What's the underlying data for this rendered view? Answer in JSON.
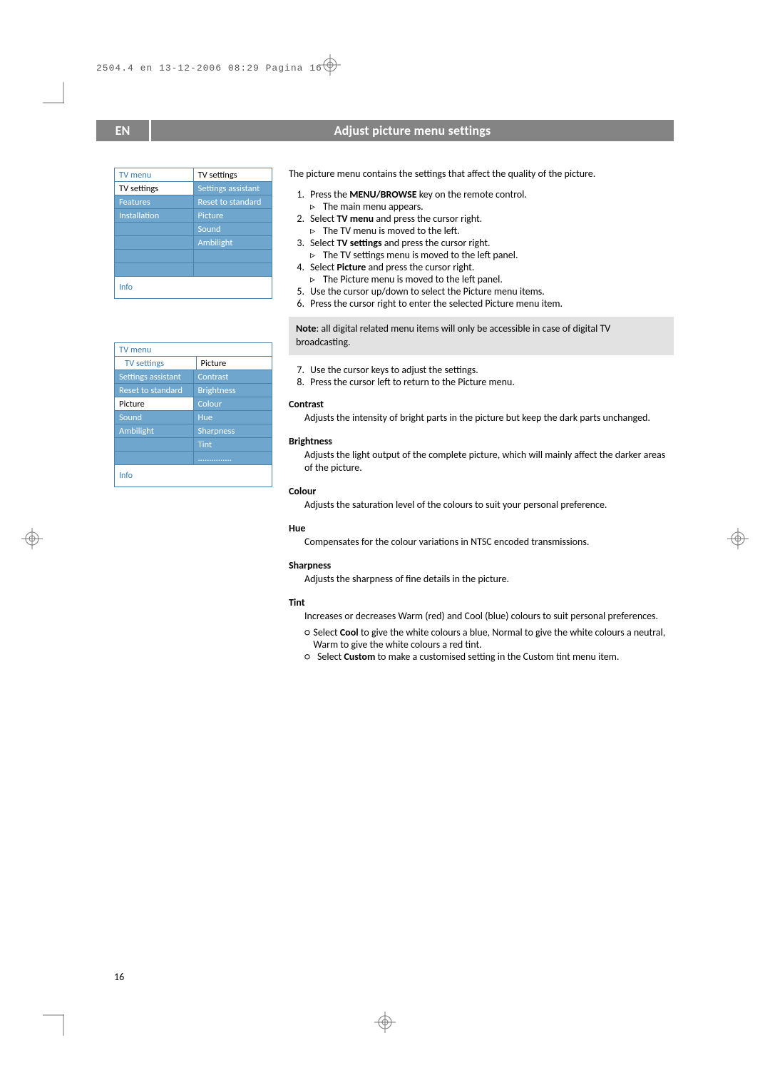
{
  "print_header": "2504.4 en  13-12-2006  08:29  Pagina 16",
  "lang": "EN",
  "title": "Adjust picture menu settings",
  "menu1": {
    "header": "TV menu",
    "header_right": "TV settings",
    "left": [
      "TV settings",
      "Features",
      "Installation"
    ],
    "right": [
      "Settings assistant",
      "Reset to standard",
      "Picture",
      "Sound",
      "Ambilight"
    ],
    "info": "Info"
  },
  "menu2": {
    "header": "TV menu",
    "crumb": "TV settings",
    "crumb_right": "Picture",
    "left": [
      "Settings assistant",
      "Reset to standard",
      "Picture",
      "Sound",
      "Ambilight"
    ],
    "right": [
      "Contrast",
      "Brightness",
      "Colour",
      "Hue",
      "Sharpness",
      "Tint",
      "..............."
    ],
    "info": "Info"
  },
  "intro": "The picture menu contains the settings that affect the quality of the picture.",
  "steps": [
    {
      "n": "1.",
      "t_pre": "Press the ",
      "b": "MENU/BROWSE",
      "t_post": " key on the remote control.",
      "sub": "The main menu appears."
    },
    {
      "n": "2.",
      "t_pre": "Select ",
      "b": "TV menu",
      "t_post": " and press the cursor right.",
      "sub": "The TV menu is moved to the left."
    },
    {
      "n": "3.",
      "t_pre": "Select ",
      "b": "TV settings",
      "t_post": " and press the cursor right.",
      "sub": "The TV settings menu is moved to the left panel."
    },
    {
      "n": "4.",
      "t_pre": "Select ",
      "b": "Picture",
      "t_post": " and press the cursor right.",
      "sub": "The Picture menu is moved to the left panel."
    },
    {
      "n": "5.",
      "t_pre": "Use the cursor up/down to select the Picture menu items.",
      "b": "",
      "t_post": "",
      "sub": ""
    },
    {
      "n": "6.",
      "t_pre": "Press the cursor right to enter the selected Picture menu item.",
      "b": "",
      "t_post": "",
      "sub": ""
    }
  ],
  "note_label": "Note",
  "note_text": ": all digital related menu items will only be accessible in case of digital TV broadcasting.",
  "steps2": [
    {
      "n": "7.",
      "t": "Use the cursor keys to adjust the settings."
    },
    {
      "n": "8.",
      "t": "Press the cursor left to return to the Picture menu."
    }
  ],
  "sections": [
    {
      "h": "Contrast",
      "body": "Adjusts the intensity of bright parts in the picture but keep the dark parts unchanged."
    },
    {
      "h": "Brightness",
      "body": "Adjusts the light output of the complete picture, which will mainly affect the darker areas of the picture."
    },
    {
      "h": "Colour",
      "body": "Adjusts the saturation level of the colours to suit your personal preference."
    },
    {
      "h": "Hue",
      "body": "Compensates for the colour variations in NTSC encoded transmissions."
    },
    {
      "h": "Sharpness",
      "body": "Adjusts the sharpness of fine details in the picture."
    }
  ],
  "tint": {
    "h": "Tint",
    "body": "Increases or decreases Warm (red) and Cool (blue) colours to suit personal preferences.",
    "b1_pre": "Select ",
    "b1_bold": "Cool",
    "b1_post": " to give the white colours a blue, Normal to give the white colours a neutral, Warm to give the white colours a red tint.",
    "b2_pre": "Select ",
    "b2_bold": "Custom",
    "b2_post": " to make a customised setting in the Custom tint menu item."
  },
  "page_number": "16"
}
